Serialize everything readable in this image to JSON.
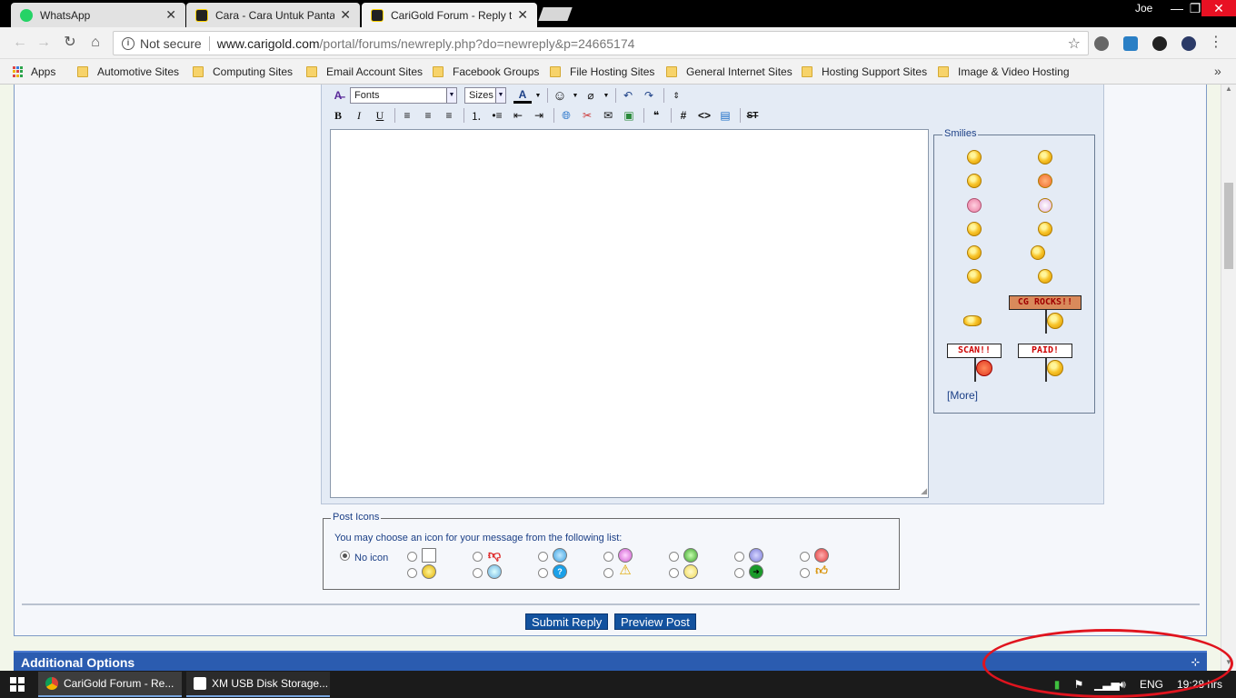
{
  "tabs": [
    {
      "title": "WhatsApp",
      "favicon_color": "#25d366"
    },
    {
      "title": "Cara - Cara Untuk Pantaska",
      "favicon_color": "#222"
    },
    {
      "title": "CariGold Forum - Reply to T",
      "favicon_color": "#222"
    }
  ],
  "tab_close": "✕",
  "profile_name": "Joe",
  "window_controls": {
    "minimize": "—",
    "restore": "❐",
    "close": "✕"
  },
  "address": {
    "security": "Not secure",
    "domain": "www.carigold.com",
    "path": "/portal/forums/newreply.php?do=newreply&p=24665174"
  },
  "bookmarks": [
    {
      "label": "Apps"
    },
    {
      "label": "Automotive Sites"
    },
    {
      "label": "Computing Sites"
    },
    {
      "label": "Email Account Sites"
    },
    {
      "label": "Facebook Groups"
    },
    {
      "label": "File Hosting Sites"
    },
    {
      "label": "General Internet Sites"
    },
    {
      "label": "Hosting Support Sites"
    },
    {
      "label": "Image & Video Hosting"
    }
  ],
  "bookmarks_more": "»",
  "editor": {
    "fonts_label": "Fonts",
    "sizes_label": "Sizes",
    "bold": "B",
    "italic": "I",
    "underline": "U",
    "hash": "#",
    "code": "<>",
    "strike": "ST"
  },
  "smilies": {
    "legend": "Smilies",
    "signs": [
      "CG ROCKS!!",
      "SCAN!!",
      "PAID!"
    ],
    "more": "[More]"
  },
  "post_icons": {
    "legend": "Post Icons",
    "description": "You may choose an icon for your message from the following list:",
    "no_icon": "No icon"
  },
  "buttons": {
    "submit": "Submit Reply",
    "preview": "Preview Post"
  },
  "additional_options": "Additional Options",
  "taskbar": {
    "tasks": [
      {
        "label": "CariGold Forum - Re..."
      },
      {
        "label": "XM USB Disk Storage..."
      }
    ],
    "language": "ENG",
    "clock": "19:28 hrs"
  },
  "colors": {
    "accent": "#13529e",
    "annotation": "#e0141e"
  }
}
